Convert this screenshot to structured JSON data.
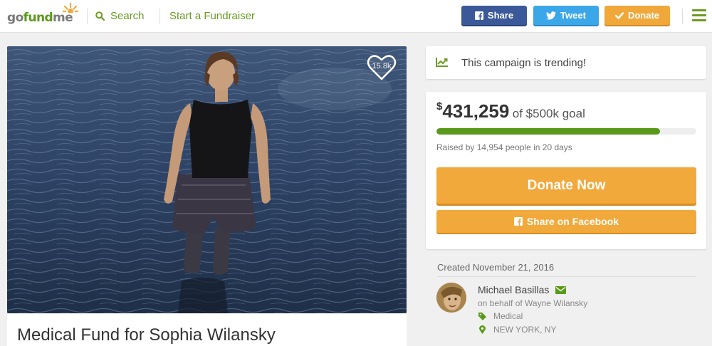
{
  "header": {
    "logo": {
      "part1": "go",
      "part2": "fund",
      "part3": "me"
    },
    "search_label": "Search",
    "start_label": "Start a Fundraiser",
    "share_label": "Share",
    "tweet_label": "Tweet",
    "donate_label": "Donate"
  },
  "campaign": {
    "heart_count": "15.8k",
    "title": "Medical Fund for Sophia Wilansky"
  },
  "trending": {
    "text": "This campaign is trending!"
  },
  "funds": {
    "currency": "$",
    "raised": "431,259",
    "goal_text": "of $500k goal",
    "progress_fraction": 0.86,
    "raised_by": "Raised by 14,954 people in 20 days",
    "donate_now_label": "Donate Now",
    "share_fb_label": "Share on Facebook"
  },
  "details": {
    "created": "Created November 21, 2016",
    "organizer": "Michael Basillas",
    "on_behalf": "on behalf of Wayne Wilansky",
    "category": "Medical",
    "location": "NEW YORK, NY"
  },
  "colors": {
    "brand_green": "#5a9a1a",
    "facebook": "#3b5998",
    "twitter": "#3ba7e8",
    "donate_orange": "#f2a93b"
  },
  "icons": [
    "search-icon",
    "facebook-icon",
    "twitter-icon",
    "check-icon",
    "menu-icon",
    "heart-icon",
    "trending-icon",
    "mail-icon",
    "tag-icon",
    "location-pin-icon"
  ]
}
